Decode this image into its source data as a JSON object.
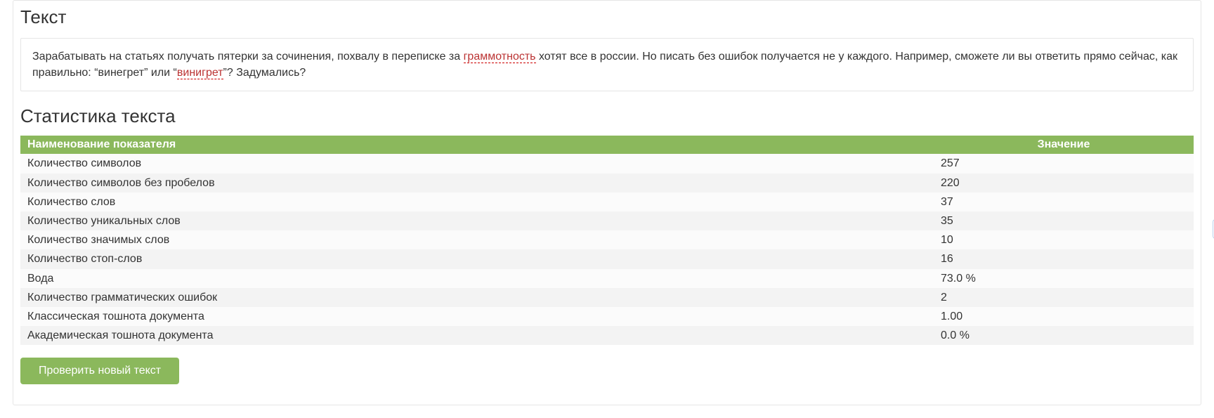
{
  "headings": {
    "text": "Текст",
    "stats": "Статистика текста"
  },
  "body_text": {
    "pre1": "Зарабатывать на статьях получать пятерки за сочинения, похвалу в переписке за ",
    "err1": "граммотность",
    "mid1": " хотят все в россии. Но писать без ошибок получается не у каждого. Например, сможете ли вы ответить прямо сейчас, как правильно: “винегрет” или “",
    "err2": "винигрет",
    "post2": "”? Задумались?"
  },
  "table": {
    "col_name": "Наименование показателя",
    "col_value": "Значение",
    "rows": [
      {
        "name": "Количество символов",
        "value": "257"
      },
      {
        "name": "Количество символов без пробелов",
        "value": "220"
      },
      {
        "name": "Количество слов",
        "value": "37"
      },
      {
        "name": "Количество уникальных слов",
        "value": "35"
      },
      {
        "name": "Количество значимых слов",
        "value": "10"
      },
      {
        "name": "Количество стоп-слов",
        "value": "16"
      },
      {
        "name": "Вода",
        "value": "73.0 %"
      },
      {
        "name": "Количество грамматических ошибок",
        "value": "2"
      },
      {
        "name": "Классическая тошнота документа",
        "value": "1.00"
      },
      {
        "name": "Академическая тошнота документа",
        "value": "0.0 %"
      }
    ]
  },
  "buttons": {
    "check_new": "Проверить новый текст"
  },
  "icons": {
    "scroll_up": "↑"
  }
}
